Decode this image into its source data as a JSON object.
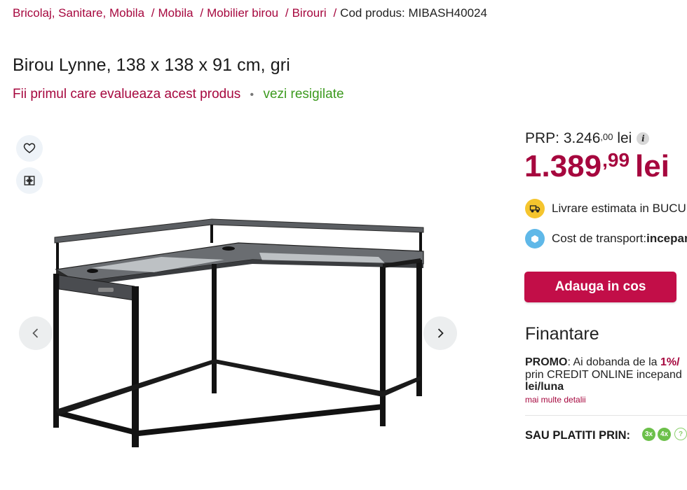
{
  "breadcrumb": {
    "items": [
      "Bricolaj, Sanitare, Mobila",
      "Mobila",
      "Mobilier birou",
      "Birouri"
    ],
    "separator": "/",
    "product_code": "Cod produs: MIBASH40024"
  },
  "product": {
    "title": "Birou Lynne, 138 x 138 x 91 cm, gri",
    "rating_prompt": "Fii primul care evalueaza acest produs",
    "rating_separator": "•",
    "resigilate_link": "vezi resigilate"
  },
  "pricing": {
    "prp_label": "PRP: 3.246",
    "prp_decimals": ",00",
    "prp_currency": "lei",
    "info_icon": "i",
    "price_integer": "1.389",
    "price_decimals": ",99",
    "price_currency": "lei"
  },
  "delivery": {
    "estimate_text": "Livrare estimata in BUCURESTI",
    "shipping_label": "Cost de transport: ",
    "shipping_value": "incepand"
  },
  "cart": {
    "add_label": "Adauga in cos"
  },
  "financing": {
    "title": "Finantare",
    "promo_label": "PROMO",
    "promo_text": ": Ai dobanda de la ",
    "promo_rate": "1%/",
    "promo_line2": "prin CREDIT ONLINE incepand",
    "promo_line3": "lei/luna",
    "more_details": "mai multe detalii",
    "pay_with_label": "SAU PLATITI PRIN:",
    "installment_chips": [
      "3x",
      "4x",
      "?"
    ]
  },
  "icons": {
    "wishlist": "heart-icon",
    "compare": "compare-icon",
    "prev": "chevron-left-icon",
    "next": "chevron-right-icon",
    "delivery": "truck-icon",
    "shipping": "box-icon"
  },
  "colors": {
    "brand": "#a6073e",
    "cta": "#c20e48",
    "green": "#3d9a1f",
    "delivery_icon_bg": "#f5c52e",
    "shipping_icon_bg": "#5fb8e8",
    "chip_green": "#6cc04a"
  }
}
